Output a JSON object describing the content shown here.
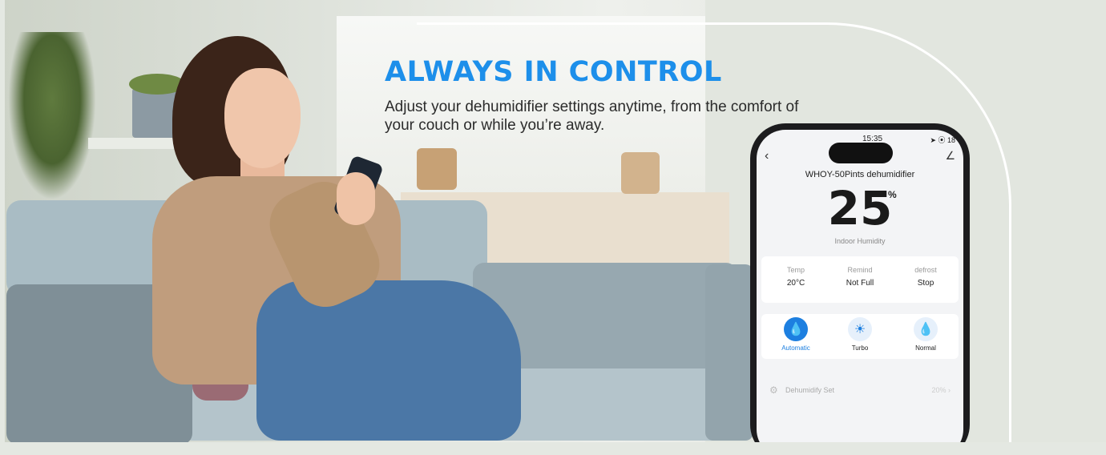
{
  "banner": {
    "headline": "ALWAYS IN CONTROL",
    "subtext": "Adjust your dehumidifier settings anytime, from the comfort of your couch or while you’re away.",
    "accent_color": "#1d8fea"
  },
  "phone": {
    "status_time": "15:35",
    "status_right": "➤ ⦿ 18",
    "back_icon": "chevron-left-icon",
    "edit_icon": "edit-icon",
    "device_name": "WHOY-50Pints dehumidifier",
    "humidity_value": "25",
    "humidity_unit": "%",
    "humidity_label": "Indoor Humidity",
    "stats": [
      {
        "label": "Temp",
        "value": "20°C"
      },
      {
        "label": "Remind",
        "value": "Not Full"
      },
      {
        "label": "defrost",
        "value": "Stop"
      }
    ],
    "modes": [
      {
        "label": "Automatic",
        "icon": "water-drop-icon",
        "active": true
      },
      {
        "label": "Turbo",
        "icon": "sun-icon",
        "active": false
      },
      {
        "label": "Normal",
        "icon": "drops-icon",
        "active": false
      }
    ],
    "setting_row": {
      "label": "Dehumidify Set",
      "value": "20% ›",
      "icon": "gear-icon"
    }
  }
}
